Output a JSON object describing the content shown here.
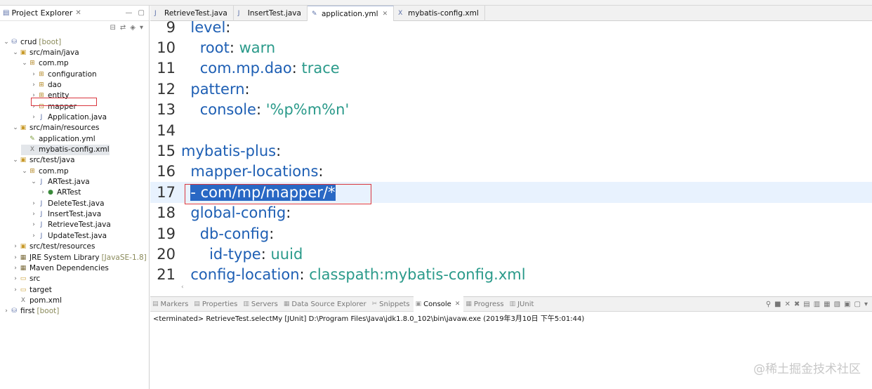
{
  "project_explorer": {
    "title": "Project Explorer",
    "tree": [
      {
        "label": "crud",
        "decoration": "[boot]",
        "depth": 0,
        "icon": "project-icon",
        "expanded": true
      },
      {
        "label": "src/main/java",
        "depth": 1,
        "icon": "source-folder-icon",
        "expanded": true
      },
      {
        "label": "com.mp",
        "depth": 2,
        "icon": "package-icon",
        "expanded": true
      },
      {
        "label": "configuration",
        "depth": 3,
        "icon": "package-icon",
        "expanded": false
      },
      {
        "label": "dao",
        "depth": 3,
        "icon": "package-icon",
        "expanded": false
      },
      {
        "label": "entity",
        "depth": 3,
        "icon": "package-icon",
        "expanded": false
      },
      {
        "label": "mapper",
        "depth": 3,
        "icon": "empty-package-icon",
        "expanded": false
      },
      {
        "label": "Application.java",
        "depth": 3,
        "icon": "java-file-icon",
        "expanded": false
      },
      {
        "label": "src/main/resources",
        "depth": 1,
        "icon": "source-folder-icon",
        "expanded": true
      },
      {
        "label": "application.yml",
        "depth": 2,
        "icon": "yml-file-icon",
        "leaf": true
      },
      {
        "label": "mybatis-config.xml",
        "depth": 2,
        "icon": "xml-file-icon",
        "leaf": true,
        "selected": true
      },
      {
        "label": "src/test/java",
        "depth": 1,
        "icon": "source-folder-icon",
        "expanded": true
      },
      {
        "label": "com.mp",
        "depth": 2,
        "icon": "package-icon",
        "expanded": true
      },
      {
        "label": "ARTest.java",
        "depth": 3,
        "icon": "java-file-icon",
        "expanded": true
      },
      {
        "label": "ARTest",
        "depth": 4,
        "icon": "class-icon",
        "expanded": false
      },
      {
        "label": "DeleteTest.java",
        "depth": 3,
        "icon": "java-file-icon",
        "expanded": false
      },
      {
        "label": "InsertTest.java",
        "depth": 3,
        "icon": "java-file-icon",
        "expanded": false
      },
      {
        "label": "RetrieveTest.java",
        "depth": 3,
        "icon": "java-file-icon",
        "expanded": false
      },
      {
        "label": "UpdateTest.java",
        "depth": 3,
        "icon": "java-file-icon",
        "expanded": false
      },
      {
        "label": "src/test/resources",
        "depth": 1,
        "icon": "source-folder-icon",
        "expanded": false
      },
      {
        "label": "JRE System Library",
        "decoration": "[JavaSE-1.8]",
        "depth": 1,
        "icon": "library-icon",
        "expanded": false
      },
      {
        "label": "Maven Dependencies",
        "depth": 1,
        "icon": "library-icon",
        "expanded": false
      },
      {
        "label": "src",
        "depth": 1,
        "icon": "folder-icon",
        "expanded": false
      },
      {
        "label": "target",
        "depth": 1,
        "icon": "folder-icon",
        "expanded": false
      },
      {
        "label": "pom.xml",
        "depth": 1,
        "icon": "xml-file-icon",
        "leaf": true
      },
      {
        "label": "first",
        "decoration": "[boot]",
        "depth": 0,
        "icon": "project-icon",
        "expanded": false
      }
    ]
  },
  "editor_tabs": [
    {
      "label": "RetrieveTest.java",
      "icon": "java-file-icon",
      "active": false
    },
    {
      "label": "InsertTest.java",
      "icon": "java-file-icon",
      "active": false
    },
    {
      "label": "application.yml",
      "icon": "yml-file-icon",
      "active": true
    },
    {
      "label": "mybatis-config.xml",
      "icon": "xml-file-icon",
      "active": false
    }
  ],
  "editor": {
    "lines": [
      {
        "num": "9",
        "indent": "  ",
        "key": "level",
        "sep": ":",
        "value": ""
      },
      {
        "num": "10",
        "indent": "    ",
        "key": "root",
        "sep": ": ",
        "value": "warn"
      },
      {
        "num": "11",
        "indent": "    ",
        "key": "com.mp.dao",
        "sep": ": ",
        "value": "trace"
      },
      {
        "num": "12",
        "indent": "  ",
        "key": "pattern",
        "sep": ":",
        "value": ""
      },
      {
        "num": "13",
        "indent": "    ",
        "key": "console",
        "sep": ": ",
        "value": "'%p%m%n'"
      },
      {
        "num": "14",
        "indent": "",
        "key": "",
        "sep": "",
        "value": ""
      },
      {
        "num": "15",
        "indent": "",
        "key": "mybatis-plus",
        "sep": ":",
        "value": ""
      },
      {
        "num": "16",
        "indent": "  ",
        "key": "mapper-locations",
        "sep": ":",
        "value": ""
      },
      {
        "num": "17",
        "indent": "  ",
        "key": "",
        "sep": "",
        "value": "",
        "selected_text": "- com/mp/mapper/*",
        "highlighted": true
      },
      {
        "num": "18",
        "indent": "  ",
        "key": "global-config",
        "sep": ":",
        "value": ""
      },
      {
        "num": "19",
        "indent": "    ",
        "key": "db-config",
        "sep": ":",
        "value": ""
      },
      {
        "num": "20",
        "indent": "      ",
        "key": "id-type",
        "sep": ": ",
        "value": "uuid"
      },
      {
        "num": "21",
        "indent": "  ",
        "key": "config-location",
        "sep": ": ",
        "value": "classpath:mybatis-config.xml"
      }
    ]
  },
  "bottom_tabs": [
    {
      "label": "Markers",
      "active": false
    },
    {
      "label": "Properties",
      "active": false
    },
    {
      "label": "Servers",
      "active": false
    },
    {
      "label": "Data Source Explorer",
      "active": false
    },
    {
      "label": "Snippets",
      "active": false
    },
    {
      "label": "Console",
      "active": true
    },
    {
      "label": "Progress",
      "active": false
    },
    {
      "label": "JUnit",
      "active": false
    }
  ],
  "console": {
    "status": "<terminated> RetrieveTest.selectMy [JUnit] D:\\Program Files\\Java\\jdk1.8.0_102\\bin\\javaw.exe (2019年3月10日 下午5:01:44)"
  },
  "watermark": "@稀土掘金技术社区",
  "colors": {
    "key": "#1e5fb4",
    "value": "#2a9a8a",
    "selection": "#2968c4",
    "current_line": "#e8f2fe",
    "annotation_box": "#d9363e"
  }
}
